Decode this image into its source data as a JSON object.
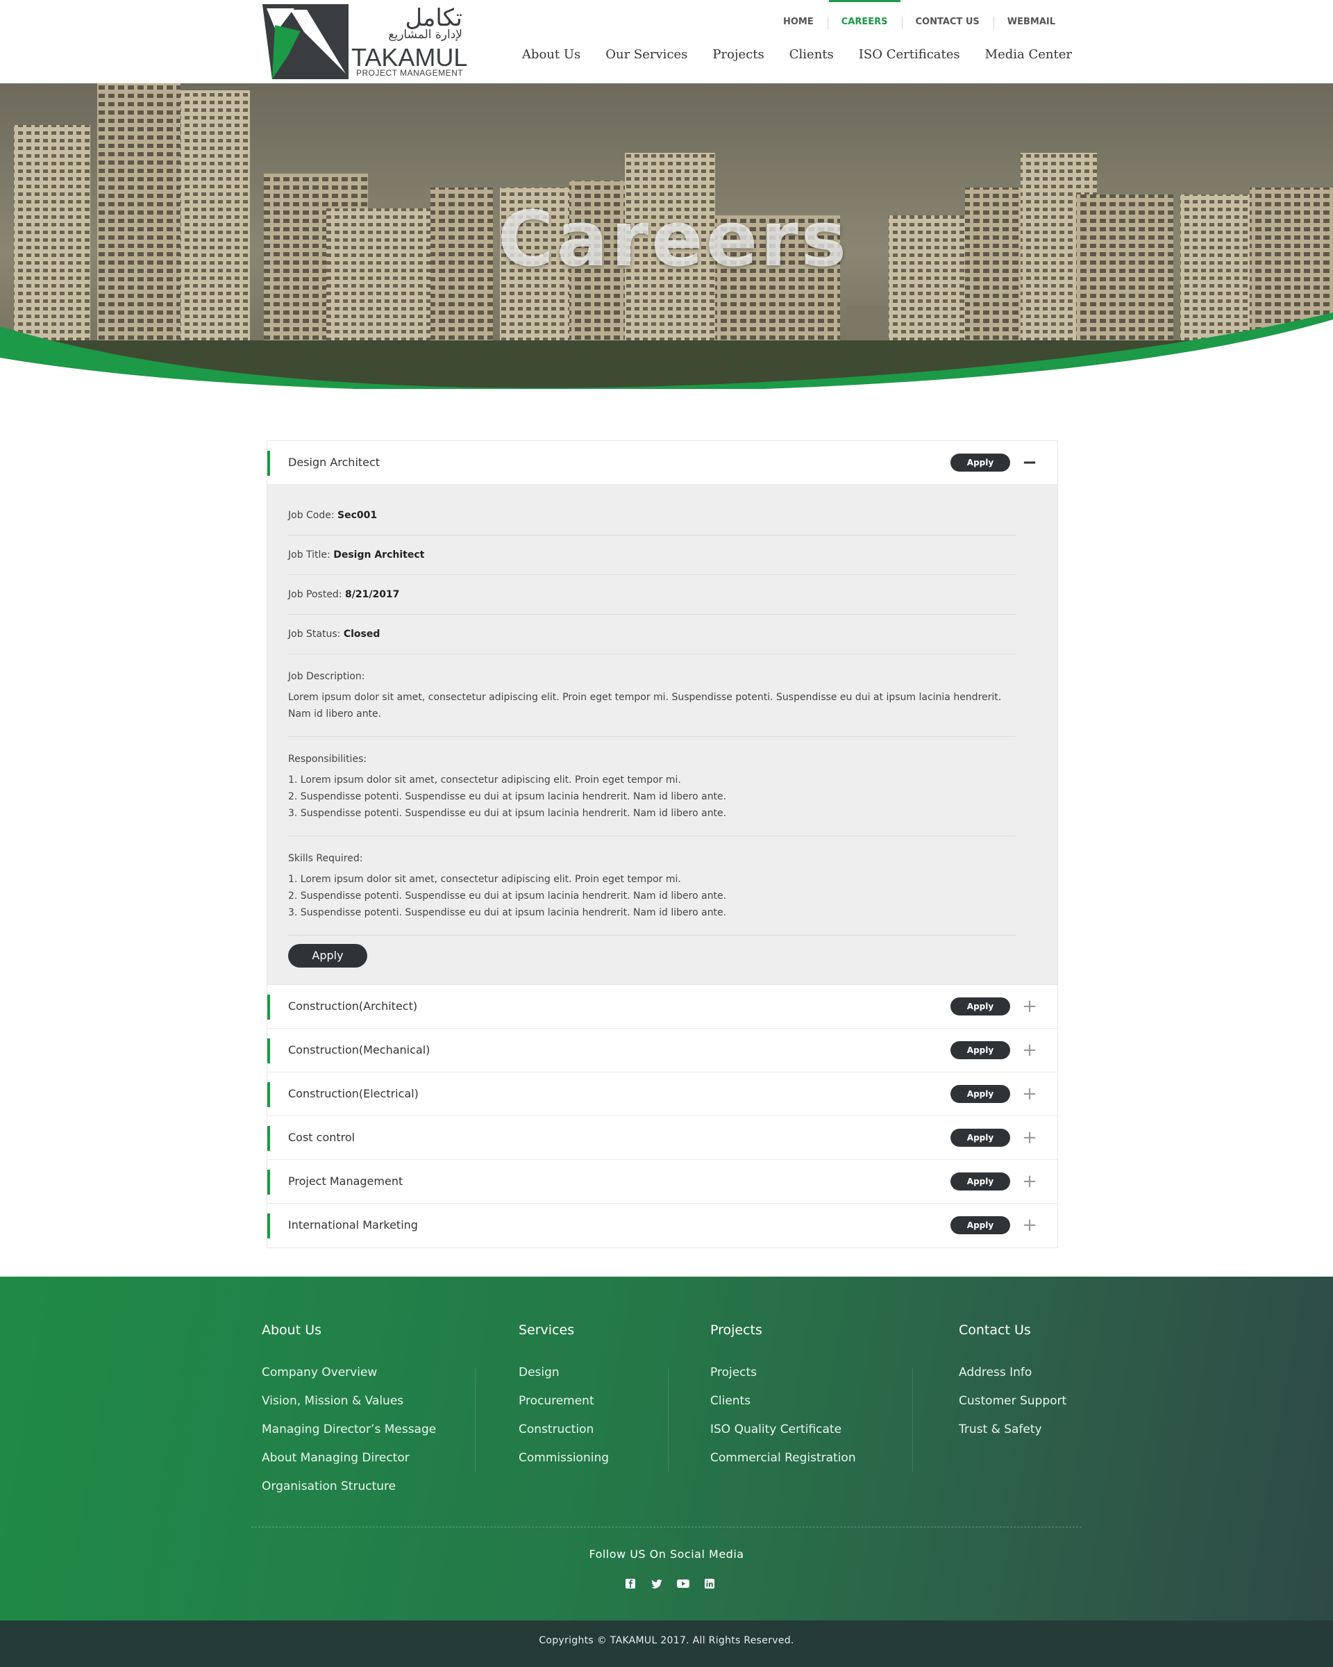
{
  "brand": {
    "arabic_name": "تكامل",
    "arabic_tagline": "لإدارة المشاريع",
    "name": "TAKAMUL",
    "subtitle": "PROJECT MANAGEMENT",
    "colors": {
      "green": "#1c9a47",
      "dark": "#2f3335"
    }
  },
  "top_nav": [
    {
      "label": "HOME"
    },
    {
      "label": "CAREERS",
      "active": true
    },
    {
      "label": "CONTACT US"
    },
    {
      "label": "WEBMAIL"
    }
  ],
  "main_nav": [
    {
      "label": "About Us"
    },
    {
      "label": "Our Services"
    },
    {
      "label": "Projects"
    },
    {
      "label": "Clients"
    },
    {
      "label": "ISO Certificates"
    },
    {
      "label": "Media Center"
    }
  ],
  "hero": {
    "title": "Careers"
  },
  "jobs": {
    "apply_label": "Apply",
    "open_job": {
      "title": "Design Architect",
      "code_label": "Job Code:",
      "code": "Sec001",
      "title_label": "Job Title:",
      "job_title": "Design Architect",
      "posted_label": "Job Posted:",
      "posted": "8/21/2017",
      "status_label": "Job Status:",
      "status": "Closed",
      "description_label": "Job Description:",
      "description": "Lorem ipsum dolor sit amet, consectetur adipiscing elit. Proin eget tempor mi. Suspendisse potenti. Suspendisse eu dui at ipsum lacinia hendrerit. Nam id libero ante.",
      "responsibilities_label": "Responsibilities:",
      "responsibilities": [
        "1. Lorem ipsum dolor sit amet, consectetur adipiscing elit. Proin eget tempor mi.",
        "2. Suspendisse potenti. Suspendisse eu dui at ipsum lacinia hendrerit. Nam id libero ante.",
        "3. Suspendisse potenti. Suspendisse eu dui at ipsum lacinia hendrerit. Nam id libero ante."
      ],
      "skills_label": "Skills Required:",
      "skills": [
        "1. Lorem ipsum dolor sit amet, consectetur adipiscing elit. Proin eget tempor mi.",
        "2. Suspendisse potenti. Suspendisse eu dui at ipsum lacinia hendrerit. Nam id libero ante.",
        "3. Suspendisse potenti. Suspendisse eu dui at ipsum lacinia hendrerit. Nam id libero ante."
      ]
    },
    "collapsed": [
      {
        "title": "Construction(Architect)"
      },
      {
        "title": "Construction(Mechanical)"
      },
      {
        "title": "Construction(Electrical)"
      },
      {
        "title": "Cost control"
      },
      {
        "title": "Project Management"
      },
      {
        "title": "International Marketing"
      }
    ]
  },
  "footer": {
    "about": {
      "heading": "About Us",
      "links": [
        "Company Overview",
        "Vision, Mission & Values",
        "Managing Director’s Message",
        "About Managing Director",
        "Organisation Structure"
      ]
    },
    "services": {
      "heading": "Services",
      "links": [
        "Design",
        "Procurement",
        "Construction",
        "Commissioning"
      ]
    },
    "projects": {
      "heading": "Projects",
      "links": [
        "Projects",
        "Clients",
        "ISO Quality Certificate",
        "Commercial Registration"
      ]
    },
    "contact": {
      "heading": "Contact Us",
      "links": [
        "Address Info",
        "Customer Support",
        "Trust & Safety"
      ]
    },
    "follow": "Follow US On Social Media",
    "social": [
      "facebook-icon",
      "twitter-icon",
      "youtube-icon",
      "linkedin-icon"
    ],
    "copyright": "Copyrights © TAKAMUL 2017. All Rights Reserved."
  }
}
